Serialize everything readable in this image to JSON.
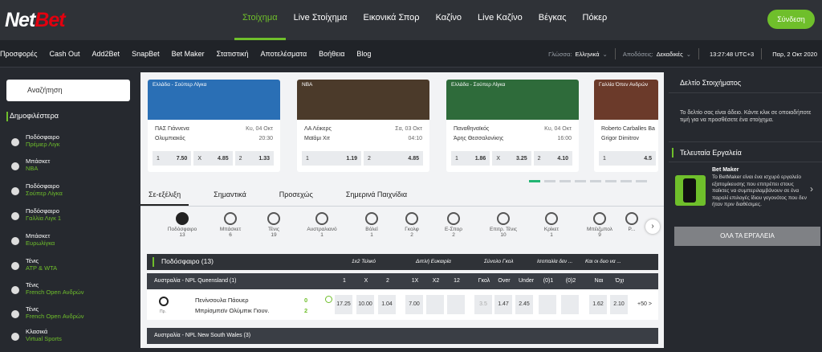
{
  "logo": {
    "net": "Net",
    "bet": "Bet"
  },
  "main_nav": [
    "Στοίχημα",
    "Live Στοίχημα",
    "Εικονικά Σπορ",
    "Καζίνο",
    "Live Καζίνο",
    "Βέγκας",
    "Πόκερ"
  ],
  "login": "Σύνδεση",
  "sub_nav": [
    "Προσφορές",
    "Cash Out",
    "Add2Bet",
    "SnapBet",
    "Bet Maker",
    "Στατιστική",
    "Αποτελέσματα",
    "Βοήθεια",
    "Blog"
  ],
  "sub_right": {
    "lang_label": "Γλώσσα:",
    "lang_value": "Ελληνικά",
    "odds_label": "Αποδόσεις:",
    "odds_value": "Δεκαδικές",
    "time": "13:27:48  UTC+3",
    "date": "Παρ, 2 Οκτ 2020"
  },
  "search": {
    "placeholder": "Αναζήτηση"
  },
  "popular": {
    "title": "Δημοφιλέστερα",
    "items": [
      {
        "sport": "Ποδόσφαιρο",
        "league": "Πρέμιερ Λιγκ"
      },
      {
        "sport": "Μπάσκετ",
        "league": "NBA"
      },
      {
        "sport": "Ποδόσφαιρο",
        "league": "Σούπερ Λίγκα"
      },
      {
        "sport": "Ποδόσφαιρο",
        "league": "Γαλλία Λιγκ 1"
      },
      {
        "sport": "Μπάσκετ",
        "league": "Ευρωλίγκα"
      },
      {
        "sport": "Τένις",
        "league": "ATP & WTA"
      },
      {
        "sport": "Τένις",
        "league": "French Open Ανδρών"
      },
      {
        "sport": "Τένις",
        "league": "French Open Ανδρών"
      },
      {
        "sport": "Κλασικά",
        "league": "Virtual Sports"
      }
    ]
  },
  "cards": [
    {
      "caption": "Ελλάδα - Σούπερ Λίγκα",
      "t1": "ΠΑΣ Γιάννενα",
      "t2": "Ολυμπιακός",
      "d1": "Κυ, 04 Οκτ",
      "d2": "20:30",
      "o1": "7.50",
      "ox": "4.85",
      "o2": "1.33",
      "c": "#2a6fb5"
    },
    {
      "caption": "NBA",
      "t1": "ΛΑ Λέικερς",
      "t2": "Μαϊάμι Χιτ",
      "d1": "Σα, 03 Οκτ",
      "d2": "04:10",
      "o1": "1.19",
      "ox": "",
      "o2": "4.85",
      "c": "#4b3a2a"
    },
    {
      "caption": "Ελλάδα - Σούπερ Λίγκα",
      "t1": "Παναθηναϊκός",
      "t2": "Άρης Θεσσαλονίκης",
      "d1": "Κυ, 04 Οκτ",
      "d2": "16:00",
      "o1": "1.86",
      "ox": "3.25",
      "o2": "4.10",
      "c": "#2e6b3a"
    },
    {
      "caption": "Γαλλία Όπεν Ανδρών",
      "t1": "Roberto Carballes Ba",
      "t2": "Grigor Dimitrov",
      "d1": "",
      "d2": "",
      "o1": "",
      "ox": "",
      "o2": "4.5",
      "c": "#6b3a2a"
    }
  ],
  "tabs": [
    "Σε-εξέλιξη",
    "Σημαντικά",
    "Προσεχώς",
    "Σημερινά Παιχνίδια"
  ],
  "sports": [
    {
      "name": "Ποδόσφαιρο",
      "count": "13"
    },
    {
      "name": "Μπάσκετ",
      "count": "6"
    },
    {
      "name": "Τένις",
      "count": "19"
    },
    {
      "name": "Αυστραλιανό",
      "count": "1"
    },
    {
      "name": "Βόλεϊ",
      "count": "1"
    },
    {
      "name": "Γκολφ",
      "count": "2"
    },
    {
      "name": "Ε-Σπορ",
      "count": "2"
    },
    {
      "name": "Επιτρ. Τένις",
      "count": "10"
    },
    {
      "name": "Κρίκετ",
      "count": "1"
    },
    {
      "name": "Μπέιζμπολ",
      "count": "9"
    },
    {
      "name": "Ρ...",
      "count": ""
    }
  ],
  "group": {
    "title": "Ποδόσφαιρο  (13)",
    "headers": [
      "1x2 Τελικό",
      "Διπλή Ευκαιρία",
      "Σύνολο Γκολ",
      "Ισοπαλία δεν ...",
      "Και οι δυο να ..."
    ]
  },
  "league1": {
    "title": "Αυστραλία - NPL Queensland (1)",
    "cols": [
      "1",
      "X",
      "2",
      "1X",
      "X2",
      "12",
      "Γκολ",
      "Over",
      "Under",
      "(0)1",
      "(0)2",
      "Ναι",
      "Όχι"
    ]
  },
  "match": {
    "team1": "Πενίνσουλα Πάουερ",
    "team2": "Μπρίσμπεϊν Ολύμπικ Γιουν.",
    "score1": "0",
    "score2": "2",
    "live": "Πρ.",
    "odds": [
      "17.25",
      "10.00",
      "1.04",
      "7.00",
      "",
      "",
      "3.5",
      "1.47",
      "2.45",
      "",
      "",
      "1.62",
      "2.10"
    ],
    "more": "+50 >"
  },
  "league2": {
    "title": "Αυστραλία - NPL New South Wales (3)"
  },
  "betslip": {
    "title": "Δελτίο Στοιχήματος",
    "text": "Το δελτίο σας είναι άδειο. Κάντε κλικ σε οποιαδήποτε τιμή για να προσθέσετε ένα στοίχημα."
  },
  "tools": {
    "title": "Τελευταία Εργαλεία",
    "bm_title": "Bet Maker",
    "bm_text": "Το BetMaker είναι ένα ισχυρό εργαλείο εξατομίκευσης που επιτρέπει στους παίκτες να συμπεριλαμβάνουν σε ένα παρολί επιλογές ίδιου γεγονότος που δεν ήταν πριν διαθέσιμες.",
    "button": "ΟΛΑ ΤΑ ΕΡΓΑΛΕΙΑ"
  },
  "colors": {
    "accent": "#6fbf2b",
    "brand_red": "#e3000f"
  }
}
